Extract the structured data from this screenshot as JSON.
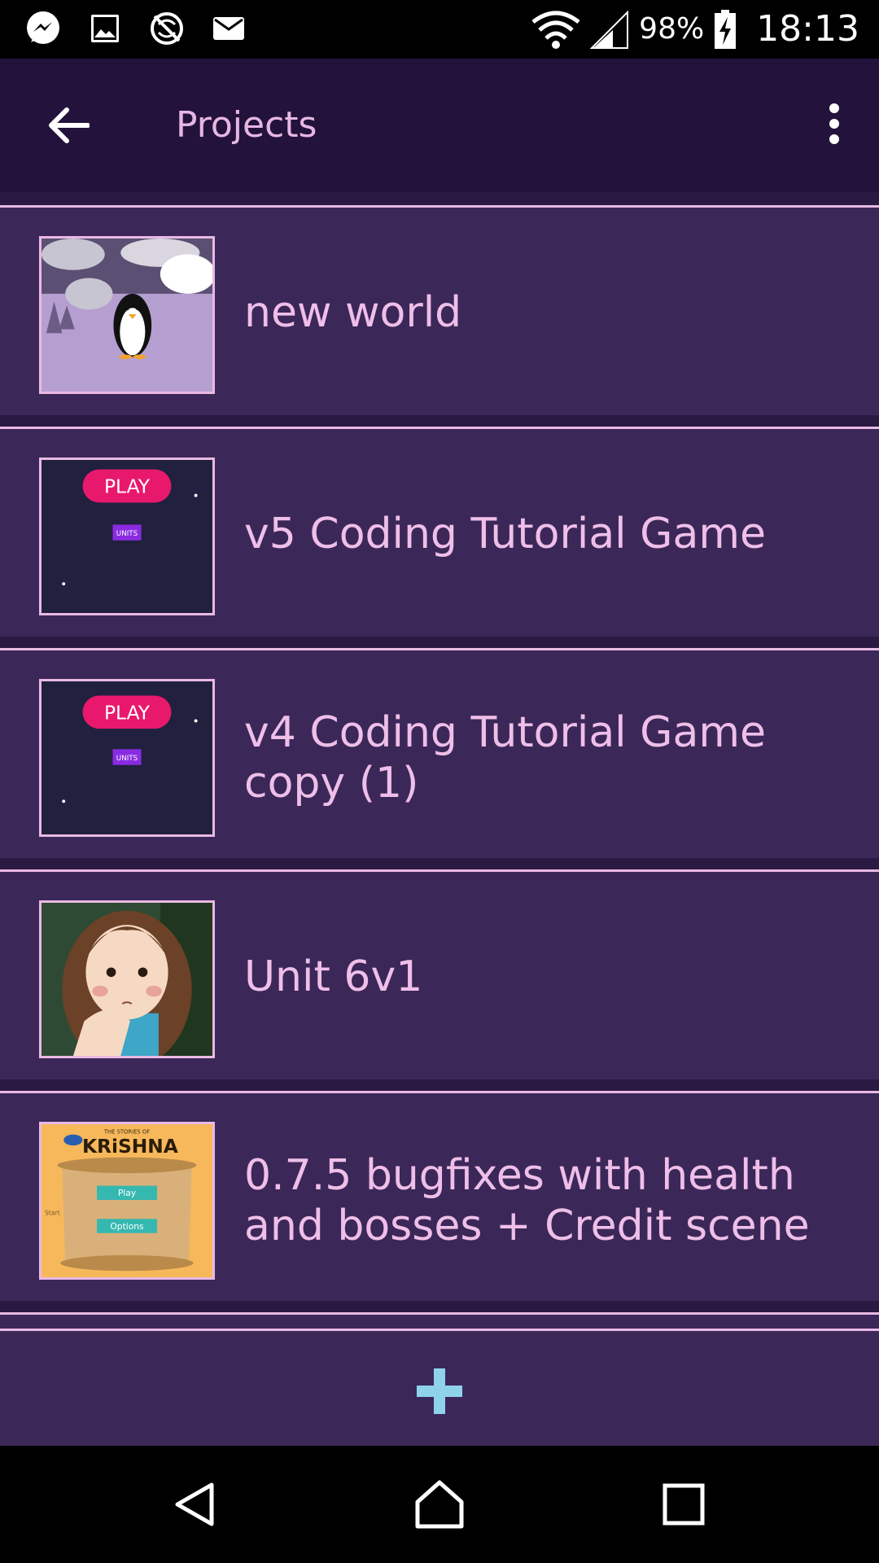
{
  "status_bar": {
    "icons_left": [
      "messenger-icon",
      "image-icon",
      "no-sync-icon",
      "mail-icon"
    ],
    "battery": "98%",
    "time": "18:13"
  },
  "app_bar": {
    "title": "Projects",
    "back_icon": "arrow-back-icon",
    "menu_icon": "more-vert-icon"
  },
  "projects": [
    {
      "name": "new world",
      "thumbnail": "penguin-snow-scene"
    },
    {
      "name": "v5 Coding Tutorial Game",
      "thumbnail": "play-menu-dark",
      "thumb_text": [
        "PLAY",
        "UNITS"
      ]
    },
    {
      "name": "v4 Coding Tutorial Game copy (1)",
      "thumbnail": "play-menu-dark",
      "thumb_text": [
        "PLAY",
        "UNITS"
      ]
    },
    {
      "name": "Unit 6v1",
      "thumbnail": "girl-character"
    },
    {
      "name": "0.7.5  bugfixes with health and bosses + Credit scene",
      "thumbnail": "krishna-scroll",
      "thumb_text": [
        "THE STORIES OF",
        "KRiSHNA",
        "Play",
        "Options",
        "Start"
      ]
    }
  ],
  "add_button": {
    "icon": "plus-icon"
  },
  "colors": {
    "app_bar_bg": "#23133c",
    "row_bg": "#3b2858",
    "text": "#efbfe9",
    "accent_plus": "#8fd3ea"
  }
}
